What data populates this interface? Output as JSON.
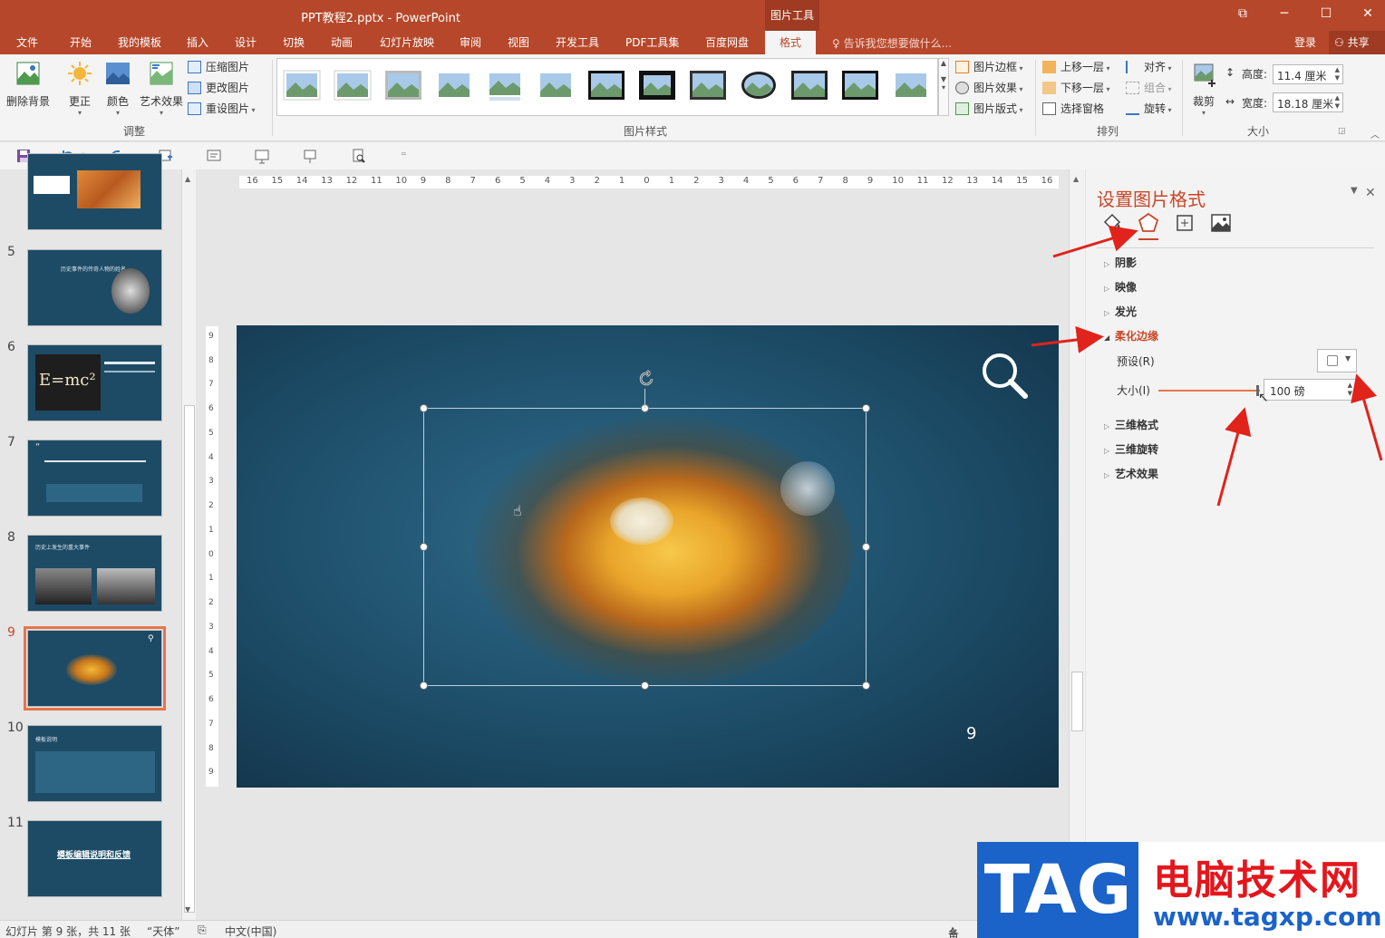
{
  "window": {
    "title": "PPT教程2.pptx - PowerPoint",
    "context_tab": "图片工具",
    "buttons": [
      "⧉",
      "─",
      "☐",
      "✕"
    ]
  },
  "tabs": [
    "文件",
    "开始",
    "我的模板",
    "插入",
    "设计",
    "切换",
    "动画",
    "幻灯片放映",
    "审阅",
    "视图",
    "开发工具",
    "PDF工具集",
    "百度网盘",
    "格式"
  ],
  "active_tab": "格式",
  "tell_me": "告诉我您想要做什么...",
  "login": "登录",
  "share": "共享",
  "ribbon": {
    "remove_bg": "删除背景",
    "corrections": "更正",
    "color": "颜色",
    "artistic": "艺术效果",
    "compress": "压缩图片",
    "change": "更改图片",
    "reset": "重设图片",
    "adjust_label": "调整",
    "styles_label": "图片样式",
    "border": "图片边框",
    "effects": "图片效果",
    "layout": "图片版式",
    "bring_forward": "上移一层",
    "send_backward": "下移一层",
    "selection_pane": "选择窗格",
    "align": "对齐",
    "group": "组合",
    "rotate": "旋转",
    "arrange_label": "排列",
    "crop": "裁剪",
    "height_label": "高度:",
    "height_value": "11.4 厘米",
    "width_label": "宽度:",
    "width_value": "18.18 厘米",
    "size_label": "大小"
  },
  "slides": [
    {
      "num": "",
      "title": ""
    },
    {
      "num": "5",
      "title": "历史事件的传奇人物的姓名"
    },
    {
      "num": "6",
      "title": "E=mc²"
    },
    {
      "num": "7",
      "title": "“"
    },
    {
      "num": "8",
      "title": "历史上发生的重大事件"
    },
    {
      "num": "9",
      "title": ""
    },
    {
      "num": "10",
      "title": "模板说明"
    },
    {
      "num": "11",
      "title": "模板编辑说明和反馈"
    }
  ],
  "active_slide": "9",
  "slide": {
    "page_number": "9"
  },
  "ruler": {
    "h": [
      "16",
      "15",
      "14",
      "13",
      "12",
      "11",
      "10",
      "9",
      "8",
      "7",
      "6",
      "5",
      "4",
      "3",
      "2",
      "1",
      "0",
      "1",
      "2",
      "3",
      "4",
      "5",
      "6",
      "7",
      "8",
      "9",
      "10",
      "11",
      "12",
      "13",
      "14",
      "15",
      "16"
    ],
    "v": [
      "9",
      "8",
      "7",
      "6",
      "5",
      "4",
      "3",
      "2",
      "1",
      "0",
      "1",
      "2",
      "3",
      "4",
      "5",
      "6",
      "7",
      "8",
      "9"
    ]
  },
  "pane": {
    "title": "设置图片格式",
    "sections": [
      "阴影",
      "映像",
      "发光",
      "柔化边缘",
      "三维格式",
      "三维旋转",
      "艺术效果"
    ],
    "open_section": "柔化边缘",
    "preset_label": "预设(R)",
    "size_label": "大小(I)",
    "size_value": "100 磅"
  },
  "status": {
    "slide_info": "幻灯片 第 9 张，共 11 张",
    "theme": "“天体”",
    "language": "中文(中国)",
    "notes": "备注"
  },
  "watermark": {
    "tag": "TAG",
    "name": "电脑技术网",
    "url": "www.tagxp.com"
  },
  "colors": {
    "accent": "#b7472a",
    "pane_title": "#c8472a",
    "slide_bg": "#1d4d68",
    "annotation": "#e0231b"
  }
}
